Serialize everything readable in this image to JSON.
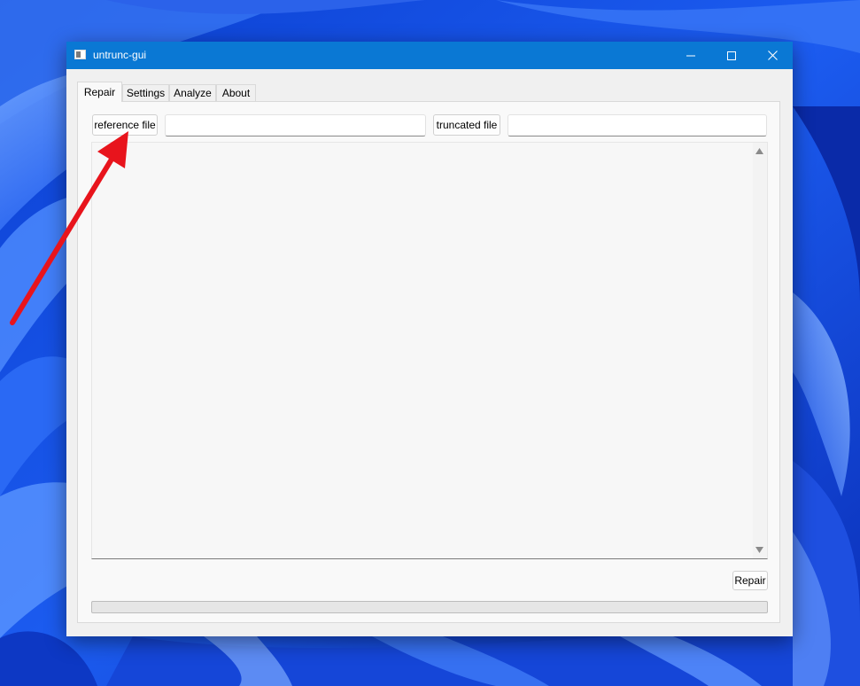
{
  "window": {
    "title": "untrunc-gui",
    "controls": [
      "minimize-icon",
      "maximize-icon",
      "close-icon"
    ]
  },
  "tabs": [
    {
      "label": "Repair",
      "active": true
    },
    {
      "label": "Settings",
      "active": false
    },
    {
      "label": "Analyze",
      "active": false
    },
    {
      "label": "About",
      "active": false
    }
  ],
  "repair": {
    "reference_button": "reference file",
    "reference_path": "",
    "truncated_button": "truncated file",
    "truncated_path": "",
    "log": "",
    "repair_button": "Repair",
    "progress": 0
  },
  "annotation": {
    "arrow_color": "#e8141c",
    "icon": "red-arrow-icon"
  },
  "colors": {
    "titlebar": "#0a78d4",
    "desktop": "#1a4fd8"
  }
}
